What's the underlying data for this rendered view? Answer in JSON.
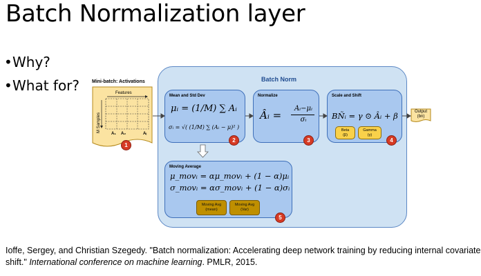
{
  "slide": {
    "title": "Batch Normalization layer",
    "bullets": [
      "Why?",
      "What for?"
    ]
  },
  "minibatch": {
    "label": "Mini-batch: Activations",
    "features_label": "Features",
    "samples_label": "M Samples",
    "columns": [
      "A₁",
      "A₂",
      "Aᵢ"
    ],
    "badge": "1"
  },
  "batch_norm": {
    "title": "Batch Norm",
    "mean_std": {
      "title": "Mean and Std Dev",
      "mean_formula": "μᵢ = (1/M) ∑ Aᵢ",
      "std_formula": "σᵢ = √( (1/M) ∑ (Aᵢ − μ)² )",
      "badge": "2"
    },
    "normalize": {
      "title": "Normalize",
      "lhs": "Âᵢ =",
      "numerator": "Aᵢ−μᵢ",
      "denominator": "σᵢ",
      "badge": "3"
    },
    "scale_shift": {
      "title": "Scale and Shift",
      "formula": "BÑᵢ = γ ⊙ Âᵢ + β",
      "beta_line1": "Beta",
      "beta_line2": "(β)",
      "gamma_line1": "Gamma",
      "gamma_line2": "(γ)",
      "badge": "4"
    },
    "moving_average": {
      "title": "Moving Average",
      "mean_formula": "μ_movᵢ = αμ_movᵢ + (1 − α)μᵢ",
      "std_formula": "σ_movᵢ = ασ_movᵢ + (1 − α)σᵢ",
      "avg_mean_line1": "Moving Avg",
      "avg_mean_line2": "(mean)",
      "avg_var_line1": "Moving Avg",
      "avg_var_line2": "(Var)",
      "badge": "5"
    }
  },
  "output": {
    "line1": "Output",
    "line2": "(bn)"
  },
  "citation": {
    "part1": "Ioffe, Sergey, and Christian Szegedy. \"Batch normalization: Accelerating deep network training by reducing internal covariate shift.\" ",
    "venue": "International conference on machine learning",
    "part2": ". PMLR, 2015."
  },
  "colors": {
    "outer_fill": "#cfe2f3",
    "inner_fill": "#a9c8ef",
    "inner_border": "#3e6fb9",
    "param_fill": "#f9d14a",
    "moving_avg_fill": "#bf8f00",
    "badge": "#d63a24",
    "paper": "#fbe3a1"
  }
}
